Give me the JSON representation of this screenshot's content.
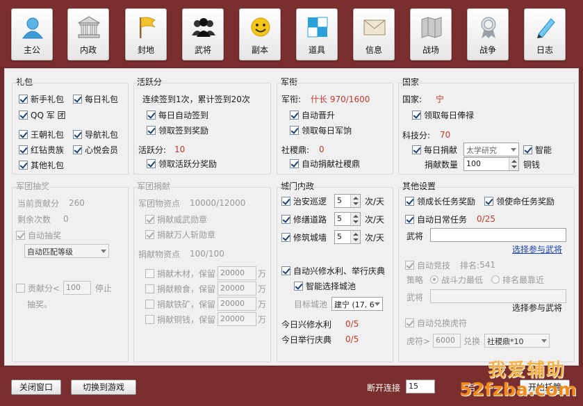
{
  "toolbar": [
    {
      "label": "主公",
      "icon": "person-icon"
    },
    {
      "label": "内政",
      "icon": "building-icon"
    },
    {
      "label": "封地",
      "icon": "flag-icon"
    },
    {
      "label": "武将",
      "icon": "group-icon"
    },
    {
      "label": "副本",
      "icon": "smiley-icon"
    },
    {
      "label": "道具",
      "icon": "tiles-icon"
    },
    {
      "label": "信息",
      "icon": "envelope-icon"
    },
    {
      "label": "战场",
      "icon": "map-icon"
    },
    {
      "label": "战争",
      "icon": "medal-icon"
    },
    {
      "label": "日志",
      "icon": "pencil-icon"
    }
  ],
  "gift": {
    "title": "礼包",
    "items": [
      "新手礼包",
      "每日礼包",
      "QQ 军 团",
      "王朝礼包",
      "导航礼包",
      "红钻贵族",
      "心悦会员",
      "其他礼包"
    ]
  },
  "activity": {
    "title": "活跃分",
    "signin_text": "连续签到1次，累计签到20次",
    "auto_signin": "每日自动签到",
    "claim_signin": "领取签到奖励",
    "score_label": "活跃分:",
    "score_value": "10",
    "claim_activity": "领取活跃分奖励"
  },
  "rank": {
    "title": "军衔",
    "rank_label": "军衔:",
    "rank_value": "什长 970/1600",
    "auto_promote": "自动晋升",
    "daily_claim": "领取每日军饷",
    "sheji_label": "社稷鼎:",
    "sheji_value": "0",
    "auto_donate": "自动捐献社稷鼎"
  },
  "country": {
    "title": "国家",
    "country_label": "国家:",
    "country_value": "宁",
    "salary": "领取每日俸禄",
    "tech_label": "科技分:",
    "tech_value": "70",
    "daily_donate": "每日捐献",
    "research": "太学研究",
    "smart": "智能",
    "donate_qty_label": "捐献数量",
    "donate_qty": "100",
    "copper": "铜钱"
  },
  "legion_lottery": {
    "title": "军团抽奖",
    "contrib_label": "当前贡献分",
    "contrib_value": "260",
    "remain_label": "剩余次数",
    "remain_value": "0",
    "auto_lottery": "自动抽奖",
    "match_select": "自动匹配等级",
    "contrib_lt": "贡献分<",
    "contrib_threshold": "100",
    "stop": "停止",
    "stop2": "抽奖。"
  },
  "legion_donate": {
    "title": "军团捐献",
    "res_label": "军团物资点",
    "res_value": "10000/12000",
    "medal1": "捐献威武勋章",
    "medal2": "捐献万人斩勋章",
    "donate_res_label": "捐献物资点",
    "donate_res_value": "100/100",
    "wood": "捐献木材，保留",
    "food": "捐献粮食，保留",
    "iron": "捐献铁矿，保留",
    "money": "捐献铜钱，保留",
    "keep": "20000",
    "unit": "万"
  },
  "city": {
    "title": "城门内政",
    "security": "治安巡逻",
    "road": "修缮道路",
    "wall": "修筑城墙",
    "times_value": "5",
    "per_day": "次/天",
    "auto_water": "自动兴修水利、举行庆典",
    "smart_city": "智能选择城池",
    "target_label": "目标城池",
    "target_value": "建宁 (17, 6",
    "water_label": "今日兴修水利",
    "water_value": "0/5",
    "festival_label": "今日举行庆典",
    "festival_value": "0/5"
  },
  "other": {
    "title": "其他设置",
    "grow": "领成长任务奖励",
    "mission": "领使命任务奖励",
    "daily_task": "自动日常任务",
    "daily_task_value": "0/25",
    "general_label": "武将",
    "select_general": "选择参与武将",
    "auto_arena": "自动竞技",
    "rank_label": "排名:",
    "rank_value": "541",
    "strategy_label": "策略",
    "strategy1": "战斗力最低",
    "strategy2": "排名最靠近",
    "general_label2": "武将",
    "select_general2": "选择参与武将",
    "auto_exchange": "自动兑换虎符",
    "tiger_label": "虎符>",
    "tiger_value": "6000",
    "exchange_label": "兑换",
    "exchange_value": "社稷鼎*10"
  },
  "footer": {
    "close": "关闭窗口",
    "switch": "切换到游戏",
    "disconnect_label": "断开连接",
    "disconnect_value": "15",
    "after_label": "后",
    "start": "开始托管"
  },
  "watermark": {
    "line1": "我爱辅助",
    "line2": "52fzba.com"
  }
}
